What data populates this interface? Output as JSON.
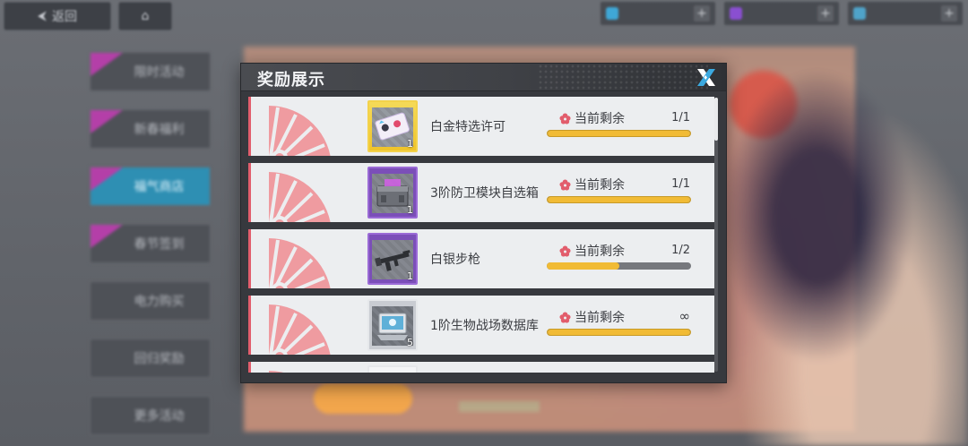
{
  "background": {
    "back_label": "返回",
    "side_tabs": [
      {
        "label": "限时活动",
        "active": false
      },
      {
        "label": "新春福利",
        "active": false
      },
      {
        "label": "福气商店",
        "active": true
      },
      {
        "label": "春节签到",
        "active": false
      },
      {
        "label": "电力购买",
        "active": false
      },
      {
        "label": "回归奖励",
        "active": false
      },
      {
        "label": "更多活动",
        "active": false
      }
    ],
    "resources": [
      {
        "icon": "energy-icon",
        "value": "",
        "color": "#3fa7d6"
      },
      {
        "icon": "crystal-icon",
        "value": "",
        "color": "#8a4fd1"
      },
      {
        "icon": "coin-icon",
        "value": "",
        "color": "#4fa3c9"
      }
    ]
  },
  "modal": {
    "title": "奖励展示",
    "close_icon": "close-x-icon",
    "colors": {
      "accent": "#e25d6c",
      "bar_fill": "#f1bb35",
      "bar_track": "#76787d"
    },
    "remain_label": "当前剩余",
    "rewards": [
      {
        "name": "白金特选许可",
        "quantity": "1",
        "remaining": "1/1",
        "fill": 1.0,
        "rarity": "gold",
        "icon": "permit-card-icon"
      },
      {
        "name": "3阶防卫模块自选箱",
        "quantity": "1",
        "remaining": "1/1",
        "fill": 1.0,
        "rarity": "purple",
        "icon": "module-box-icon"
      },
      {
        "name": "白银步枪",
        "quantity": "1",
        "remaining": "1/2",
        "fill": 0.5,
        "rarity": "purple",
        "icon": "rifle-icon"
      },
      {
        "name": "1阶生物战场数据库",
        "quantity": "5",
        "remaining": "∞",
        "fill": 1.0,
        "rarity": "silver",
        "icon": "data-tablet-icon"
      },
      {
        "name": "",
        "quantity": "",
        "remaining": "",
        "fill": 0,
        "rarity": "silver",
        "icon": "item-icon"
      }
    ]
  }
}
